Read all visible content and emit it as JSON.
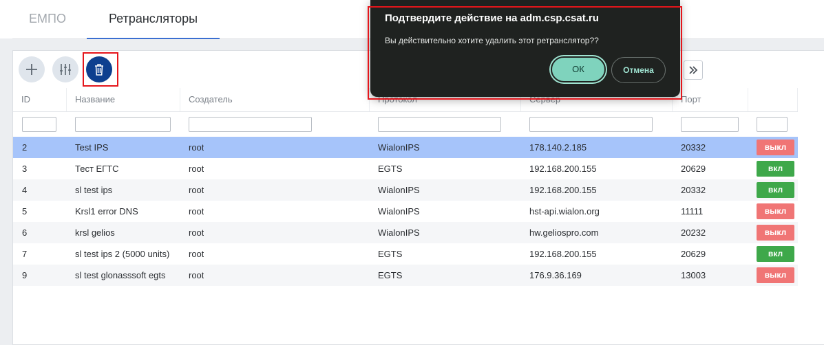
{
  "tabs": [
    {
      "label": "ЕМПО",
      "active": false
    },
    {
      "label": "Ретрансляторы",
      "active": true
    }
  ],
  "toolbar": {
    "add_icon": "plus-icon",
    "filter_icon": "sliders-icon",
    "delete_icon": "trash-icon",
    "next_icon": "double-chevron-right-icon"
  },
  "table": {
    "columns": [
      "ID",
      "Название",
      "Создатель",
      "Протокол",
      "Сервер",
      "Порт"
    ],
    "rows": [
      {
        "id": "2",
        "name": "Test IPS",
        "creator": "root",
        "protocol": "WialonIPS",
        "server": "178.140.2.185",
        "port": "20332",
        "status": "выкл"
      },
      {
        "id": "3",
        "name": "Тест ЕГТС",
        "creator": "root",
        "protocol": "EGTS",
        "server": "192.168.200.155",
        "port": "20629",
        "status": "вкл"
      },
      {
        "id": "4",
        "name": "sl test ips",
        "creator": "root",
        "protocol": "WialonIPS",
        "server": "192.168.200.155",
        "port": "20332",
        "status": "вкл"
      },
      {
        "id": "5",
        "name": "Krsl1 error DNS",
        "creator": "root",
        "protocol": "WialonIPS",
        "server": "hst-api.wialon.org",
        "port": "11111",
        "status": "выкл"
      },
      {
        "id": "6",
        "name": "krsl gelios",
        "creator": "root",
        "protocol": "WialonIPS",
        "server": "hw.geliospro.com",
        "port": "20232",
        "status": "выкл"
      },
      {
        "id": "7",
        "name": "sl test ips 2 (5000 units)",
        "creator": "root",
        "protocol": "EGTS",
        "server": "192.168.200.155",
        "port": "20629",
        "status": "вкл"
      },
      {
        "id": "9",
        "name": "sl test glonasssoft egts",
        "creator": "root",
        "protocol": "EGTS",
        "server": "176.9.36.169",
        "port": "13003",
        "status": "выкл"
      }
    ],
    "selected_row_id": "2"
  },
  "dialog": {
    "title": "Подтвердите действие на adm.csp.csat.ru",
    "message": "Вы действительно хотите удалить этот ретранслятор??",
    "ok_label": "ОК",
    "cancel_label": "Отмена"
  },
  "colors": {
    "status_on": "#3ea84a",
    "status_off": "#f07575",
    "selected_row": "#a6c4fa",
    "accent": "#0d3f8f",
    "dialog_bg": "#1f2220",
    "ok_button": "#7fd3bd"
  }
}
